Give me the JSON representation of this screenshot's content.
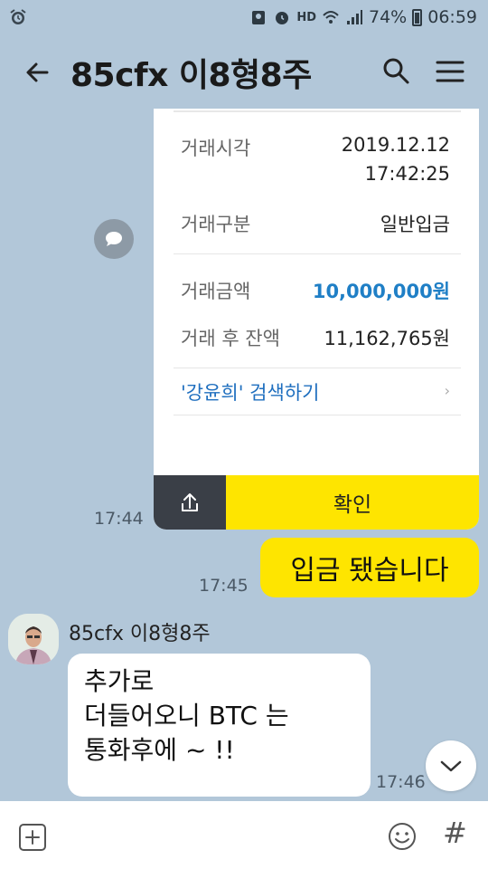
{
  "status_bar": {
    "left_icon": "alarm-icon",
    "hd_label": "HD",
    "battery_percent": "74%",
    "time": "06:59"
  },
  "header": {
    "title": "85cfx 이8형8주",
    "back_icon": "back-arrow-icon",
    "search_icon": "search-icon",
    "menu_icon": "menu-icon"
  },
  "card": {
    "rows": [
      {
        "label": "거래시각",
        "value_line1": "2019.12.12",
        "value_line2": "17:42:25"
      },
      {
        "label": "거래구분",
        "value": "일반입금"
      },
      {
        "label": "거래금액",
        "value": "10,000,000원"
      },
      {
        "label": "거래 후 잔액",
        "value": "11,162,765원"
      }
    ],
    "search_link": "'강윤희' 검색하기",
    "chevron": "›",
    "confirm_label": "확인",
    "card_time": "17:44"
  },
  "my_message": {
    "text": "입금 됐습니다",
    "time": "17:45"
  },
  "other_message": {
    "sender": "85cfx 이8형8주",
    "lines": [
      "추가로",
      "더들어오니 BTC 는",
      "통화후에 ~ !!"
    ],
    "time": "17:46"
  },
  "colors": {
    "chat_bg": "#b2c7d9",
    "yellow": "#fee500",
    "link_blue": "#1f6fbf",
    "amount_blue": "#1f7fc6"
  }
}
